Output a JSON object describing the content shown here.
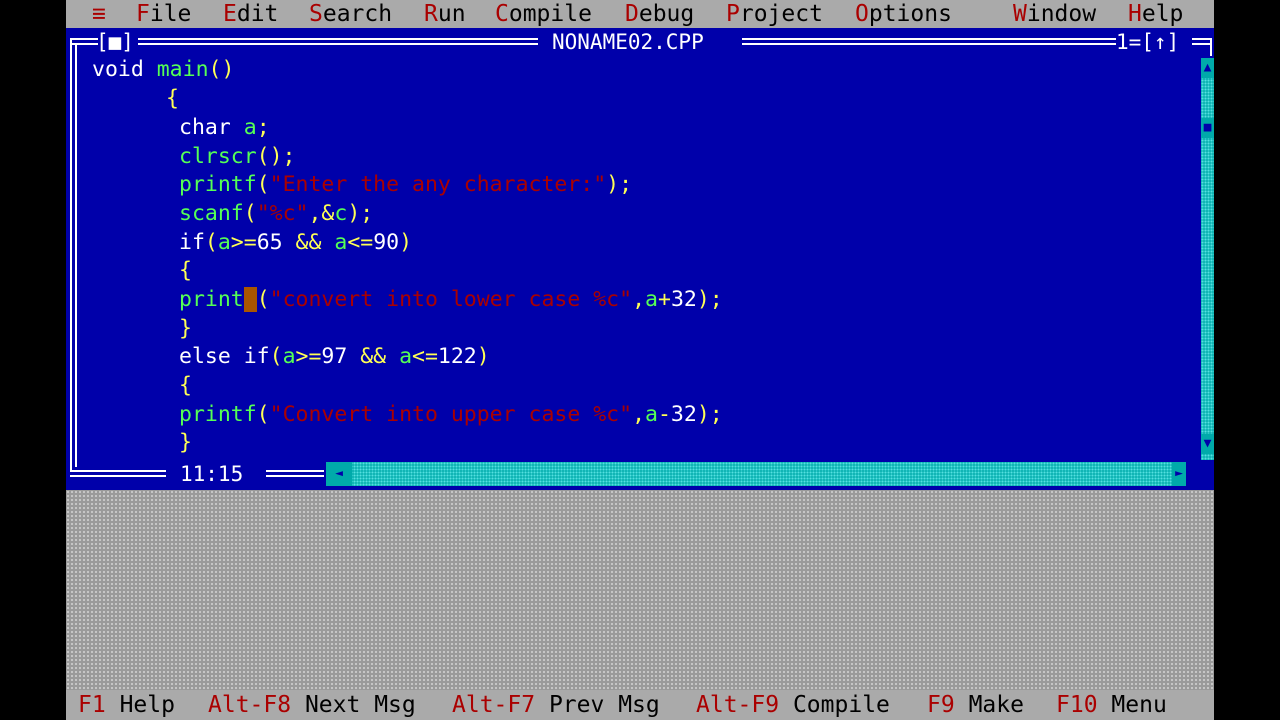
{
  "menu": [
    {
      "hotkey": "≡",
      "rest": ""
    },
    {
      "hotkey": "F",
      "rest": "ile"
    },
    {
      "hotkey": "E",
      "rest": "dit"
    },
    {
      "hotkey": "S",
      "rest": "earch"
    },
    {
      "hotkey": "R",
      "rest": "un"
    },
    {
      "hotkey": "C",
      "rest": "ompile"
    },
    {
      "hotkey": "D",
      "rest": "ebug"
    },
    {
      "hotkey": "P",
      "rest": "roject"
    },
    {
      "hotkey": "O",
      "rest": "ptions"
    },
    {
      "hotkey": "W",
      "rest": "indow"
    },
    {
      "hotkey": "H",
      "rest": "elp"
    }
  ],
  "editor": {
    "close_box": "[■]",
    "title": "NONAME02.CPP",
    "window_number": "1=[↑]",
    "cursor_position": "11:15",
    "scroll_up": "▲",
    "scroll_down": "▼",
    "scroll_thumb": "■",
    "scroll_left": "◄",
    "scroll_right": "►",
    "code": {
      "l1": {
        "a": "void ",
        "b": "main",
        "c": "()"
      },
      "l2": {
        "a": "{"
      },
      "l3": {
        "a": "char ",
        "b": "a",
        "c": ";"
      },
      "l4": {
        "a": "clrscr",
        "b": "();"
      },
      "l5": {
        "a": "printf",
        "b": "(",
        "c": "\"Enter the any character:\"",
        "d": ");"
      },
      "l6": {
        "a": "scanf",
        "b": "(",
        "c": "\"%c\"",
        "d": ",&",
        "e": "c",
        "f": ");"
      },
      "l7": {
        "a": "if",
        "b": "(",
        "c": "a",
        "d": ">=",
        "e": "65",
        "f": " && ",
        "g": "a",
        "h": "<=",
        "i": "90",
        "j": ")"
      },
      "l8": {
        "a": "{"
      },
      "l9": {
        "a": "print",
        "b": "f",
        "c": "(",
        "d": "\"convert into lower case %c\"",
        "e": ",",
        "f": "a",
        "g": "+",
        "h": "32",
        "i": ");"
      },
      "l10": {
        "a": "}"
      },
      "l11": {
        "a": "else if",
        "b": "(",
        "c": "a",
        "d": ">=",
        "e": "97",
        "f": " && ",
        "g": "a",
        "h": "<=",
        "i": "122",
        "j": ")"
      },
      "l12": {
        "a": "{"
      },
      "l13": {
        "a": "printf",
        "b": "(",
        "c": "\"Convert into upper case %c\"",
        "d": ",",
        "e": "a",
        "f": "-",
        "g": "32",
        "h": ");"
      },
      "l14": {
        "a": "}"
      }
    }
  },
  "status": [
    {
      "key": "F1",
      "label": "Help"
    },
    {
      "key": "Alt-F8",
      "label": "Next Msg"
    },
    {
      "key": "Alt-F7",
      "label": "Prev Msg"
    },
    {
      "key": "Alt-F9",
      "label": "Compile"
    },
    {
      "key": "F9",
      "label": "Make"
    },
    {
      "key": "F10",
      "label": "Menu"
    }
  ],
  "colors": {
    "editor_bg": "#0000aa",
    "menu_bg": "#aaaaaa",
    "hotkey": "#aa0000",
    "identifier": "#55ff55",
    "string": "#aa0000",
    "symbol": "#ffff55",
    "scrollbar": "#00aaaa"
  }
}
